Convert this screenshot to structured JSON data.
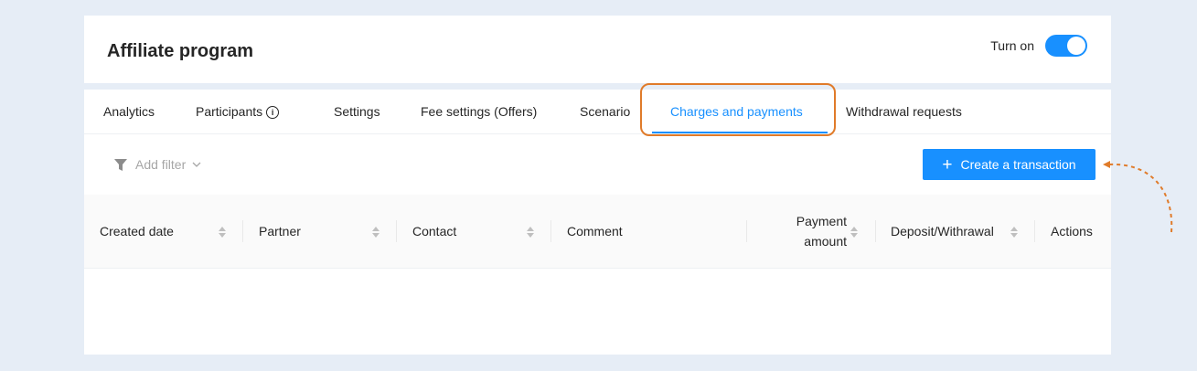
{
  "header": {
    "title": "Affiliate program",
    "toggle_label": "Turn on",
    "toggle_on": true
  },
  "tabs": [
    {
      "label": "Analytics"
    },
    {
      "label": "Participants",
      "info": true
    },
    {
      "label": "Settings"
    },
    {
      "label": "Fee settings (Offers)"
    },
    {
      "label": "Scenario"
    },
    {
      "label": "Charges and payments",
      "active": true
    },
    {
      "label": "Withdrawal requests"
    }
  ],
  "toolbar": {
    "filter_label": "Add filter",
    "create_label": "Create a transaction"
  },
  "table": {
    "columns": [
      {
        "label": "Created date",
        "sortable": true
      },
      {
        "label": "Partner",
        "sortable": true
      },
      {
        "label": "Contact",
        "sortable": true
      },
      {
        "label": "Comment",
        "sortable": false
      },
      {
        "label_line1": "Payment",
        "label_line2": "amount",
        "sortable": true
      },
      {
        "label": "Deposit/Withrawal",
        "sortable": true
      },
      {
        "label": "Actions",
        "sortable": false
      }
    ],
    "rows": []
  },
  "colors": {
    "accent": "#1890ff",
    "highlight": "#e07b2a",
    "background": "#e6edf6"
  }
}
